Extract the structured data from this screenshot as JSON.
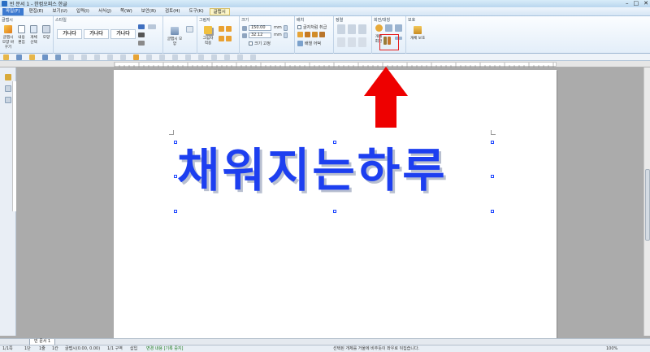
{
  "window": {
    "title": "빈 문서 1 - 한컴오피스 한글",
    "controls": [
      "–",
      "□",
      "✕"
    ]
  },
  "menu": {
    "items": [
      {
        "label": "파일(F)",
        "state": "active"
      },
      {
        "label": "편집(E)",
        "state": ""
      },
      {
        "label": "보기(U)",
        "state": ""
      },
      {
        "label": "입력(I)",
        "state": ""
      },
      {
        "label": "서식(J)",
        "state": ""
      },
      {
        "label": "쪽(W)",
        "state": ""
      },
      {
        "label": "보안(R)",
        "state": ""
      },
      {
        "label": "검토(H)",
        "state": ""
      },
      {
        "label": "도구(K)",
        "state": ""
      },
      {
        "label": "글맵시",
        "state": "ctx"
      }
    ]
  },
  "ribbon": {
    "group_wordart": "글맵시",
    "btn_change_wordart": "글맵시 모양 바꾸기",
    "btn_content_edit": "내용 편집",
    "btn_char_select": "개체 선택",
    "btn_shape": "모양",
    "group_style": "스타일",
    "styles": [
      "가나다",
      "가나다",
      "가나다"
    ],
    "btn_wordart_shape": "글맵시 모양",
    "group_shadow": "그림자",
    "btn_shadow": "그림자 적용",
    "group_size": "크기",
    "width_value": "150.00",
    "height_value": "32.12",
    "unit_mm": "mm",
    "keep_ratio": "크기 고정",
    "group_arrange": "배치",
    "treat_as_char": "글자처럼 취급",
    "text_wrap": "배열 어떡",
    "group_align": "정렬",
    "group_rotate": "회전/대칭",
    "btn_rotate": "개체 회전",
    "group_protect": "보호",
    "btn_protect": "개체 보호"
  },
  "doc": {
    "wordart_text": "채워지는하루"
  },
  "tabs": {
    "doc_tab": "빈 문서 1"
  },
  "status": {
    "page": "1/1쪽",
    "section": "1단",
    "line": "1줄",
    "col": "1칸",
    "wordart_pos": "글맵시(0.00, 0.00)",
    "area": "1/1 구역",
    "insert": "삽입",
    "track": "변경 내용 [기록 중지]",
    "hint": "선택된 개체를 거울에 비추듯이 좌우로 뒤집습니다.",
    "zoom": "100%"
  },
  "colors": {
    "wordart": "#1d3ff0",
    "highlight": "#e51b1b",
    "arrow": "#ee0000",
    "active_menu": "#3d7ad0"
  }
}
